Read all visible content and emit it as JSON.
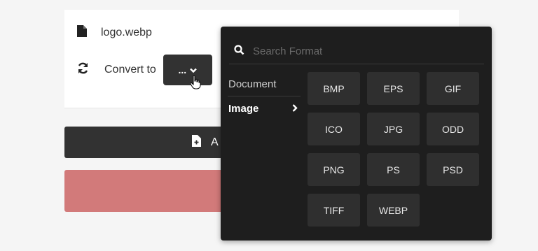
{
  "file": {
    "name": "logo.webp",
    "icon": "file-icon"
  },
  "convert": {
    "label": "Convert to",
    "button_label": "...",
    "icon": "sync-icon"
  },
  "add_bar": {
    "label": "A"
  },
  "dropdown": {
    "search_placeholder": "Search Format",
    "categories": [
      {
        "label": "Document",
        "active": false
      },
      {
        "label": "Image",
        "active": true
      }
    ],
    "formats": [
      "BMP",
      "EPS",
      "GIF",
      "ICO",
      "JPG",
      "ODD",
      "PNG",
      "PS",
      "PSD",
      "TIFF",
      "WEBP"
    ]
  }
}
